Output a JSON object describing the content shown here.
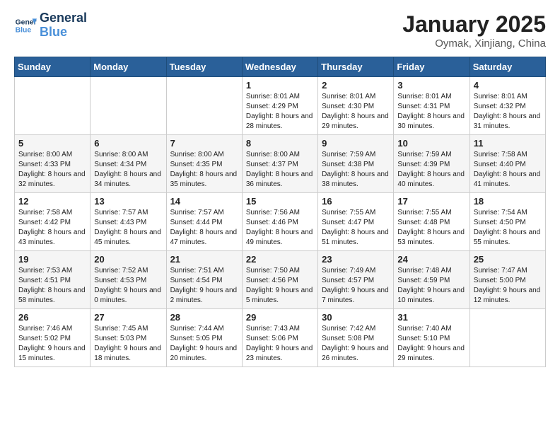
{
  "logo": {
    "line1": "General",
    "line2": "Blue"
  },
  "title": "January 2025",
  "location": "Oymak, Xinjiang, China",
  "days_of_week": [
    "Sunday",
    "Monday",
    "Tuesday",
    "Wednesday",
    "Thursday",
    "Friday",
    "Saturday"
  ],
  "weeks": [
    [
      {
        "day": "",
        "info": ""
      },
      {
        "day": "",
        "info": ""
      },
      {
        "day": "",
        "info": ""
      },
      {
        "day": "1",
        "info": "Sunrise: 8:01 AM\nSunset: 4:29 PM\nDaylight: 8 hours and 28 minutes."
      },
      {
        "day": "2",
        "info": "Sunrise: 8:01 AM\nSunset: 4:30 PM\nDaylight: 8 hours and 29 minutes."
      },
      {
        "day": "3",
        "info": "Sunrise: 8:01 AM\nSunset: 4:31 PM\nDaylight: 8 hours and 30 minutes."
      },
      {
        "day": "4",
        "info": "Sunrise: 8:01 AM\nSunset: 4:32 PM\nDaylight: 8 hours and 31 minutes."
      }
    ],
    [
      {
        "day": "5",
        "info": "Sunrise: 8:00 AM\nSunset: 4:33 PM\nDaylight: 8 hours and 32 minutes."
      },
      {
        "day": "6",
        "info": "Sunrise: 8:00 AM\nSunset: 4:34 PM\nDaylight: 8 hours and 34 minutes."
      },
      {
        "day": "7",
        "info": "Sunrise: 8:00 AM\nSunset: 4:35 PM\nDaylight: 8 hours and 35 minutes."
      },
      {
        "day": "8",
        "info": "Sunrise: 8:00 AM\nSunset: 4:37 PM\nDaylight: 8 hours and 36 minutes."
      },
      {
        "day": "9",
        "info": "Sunrise: 7:59 AM\nSunset: 4:38 PM\nDaylight: 8 hours and 38 minutes."
      },
      {
        "day": "10",
        "info": "Sunrise: 7:59 AM\nSunset: 4:39 PM\nDaylight: 8 hours and 40 minutes."
      },
      {
        "day": "11",
        "info": "Sunrise: 7:58 AM\nSunset: 4:40 PM\nDaylight: 8 hours and 41 minutes."
      }
    ],
    [
      {
        "day": "12",
        "info": "Sunrise: 7:58 AM\nSunset: 4:42 PM\nDaylight: 8 hours and 43 minutes."
      },
      {
        "day": "13",
        "info": "Sunrise: 7:57 AM\nSunset: 4:43 PM\nDaylight: 8 hours and 45 minutes."
      },
      {
        "day": "14",
        "info": "Sunrise: 7:57 AM\nSunset: 4:44 PM\nDaylight: 8 hours and 47 minutes."
      },
      {
        "day": "15",
        "info": "Sunrise: 7:56 AM\nSunset: 4:46 PM\nDaylight: 8 hours and 49 minutes."
      },
      {
        "day": "16",
        "info": "Sunrise: 7:55 AM\nSunset: 4:47 PM\nDaylight: 8 hours and 51 minutes."
      },
      {
        "day": "17",
        "info": "Sunrise: 7:55 AM\nSunset: 4:48 PM\nDaylight: 8 hours and 53 minutes."
      },
      {
        "day": "18",
        "info": "Sunrise: 7:54 AM\nSunset: 4:50 PM\nDaylight: 8 hours and 55 minutes."
      }
    ],
    [
      {
        "day": "19",
        "info": "Sunrise: 7:53 AM\nSunset: 4:51 PM\nDaylight: 8 hours and 58 minutes."
      },
      {
        "day": "20",
        "info": "Sunrise: 7:52 AM\nSunset: 4:53 PM\nDaylight: 9 hours and 0 minutes."
      },
      {
        "day": "21",
        "info": "Sunrise: 7:51 AM\nSunset: 4:54 PM\nDaylight: 9 hours and 2 minutes."
      },
      {
        "day": "22",
        "info": "Sunrise: 7:50 AM\nSunset: 4:56 PM\nDaylight: 9 hours and 5 minutes."
      },
      {
        "day": "23",
        "info": "Sunrise: 7:49 AM\nSunset: 4:57 PM\nDaylight: 9 hours and 7 minutes."
      },
      {
        "day": "24",
        "info": "Sunrise: 7:48 AM\nSunset: 4:59 PM\nDaylight: 9 hours and 10 minutes."
      },
      {
        "day": "25",
        "info": "Sunrise: 7:47 AM\nSunset: 5:00 PM\nDaylight: 9 hours and 12 minutes."
      }
    ],
    [
      {
        "day": "26",
        "info": "Sunrise: 7:46 AM\nSunset: 5:02 PM\nDaylight: 9 hours and 15 minutes."
      },
      {
        "day": "27",
        "info": "Sunrise: 7:45 AM\nSunset: 5:03 PM\nDaylight: 9 hours and 18 minutes."
      },
      {
        "day": "28",
        "info": "Sunrise: 7:44 AM\nSunset: 5:05 PM\nDaylight: 9 hours and 20 minutes."
      },
      {
        "day": "29",
        "info": "Sunrise: 7:43 AM\nSunset: 5:06 PM\nDaylight: 9 hours and 23 minutes."
      },
      {
        "day": "30",
        "info": "Sunrise: 7:42 AM\nSunset: 5:08 PM\nDaylight: 9 hours and 26 minutes."
      },
      {
        "day": "31",
        "info": "Sunrise: 7:40 AM\nSunset: 5:10 PM\nDaylight: 9 hours and 29 minutes."
      },
      {
        "day": "",
        "info": ""
      }
    ]
  ]
}
